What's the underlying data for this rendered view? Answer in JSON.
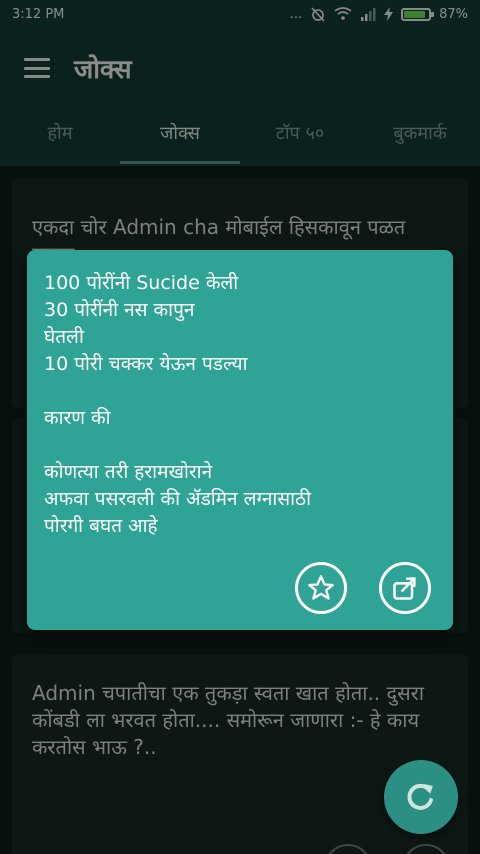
{
  "status": {
    "time": "3:12 PM",
    "battery": "87%",
    "battery_level": 0.87,
    "indicators": "..."
  },
  "app": {
    "title": "जोक्स"
  },
  "tabs": [
    {
      "label": "होम"
    },
    {
      "label": "जोक्स"
    },
    {
      "label": "टॉप ५०"
    },
    {
      "label": "बुकमार्क"
    }
  ],
  "cards": [
    {
      "text": "एकदा चोर Admin cha  मोबाईल हिसकावून पळत सुटला"
    },
    {
      "text": ""
    },
    {
      "text": "Admin चपातीचा एक तुकड़ा स्वता खात होता.. दुसरा कोंबडी ला भरवत होता.... समोरून जाणारा :-  हे काय करतोस भाऊ ?.."
    }
  ],
  "dialog": {
    "text": "100 पोरींनी Sucide केली\n30 पोरींनी नस कापुन\nघेतली\n10 पोरी चक्कर येऊन पडल्या\n\nकारण की\n\nकोणत्या तरी हरामखोराने\nअफवा पसरवली की ॲडमिन लग्नासाठी\nपोरगी बघत आहे"
  },
  "colors": {
    "accent": "#2fa396",
    "appbar": "#133a34",
    "fab": "#2b8f84"
  }
}
